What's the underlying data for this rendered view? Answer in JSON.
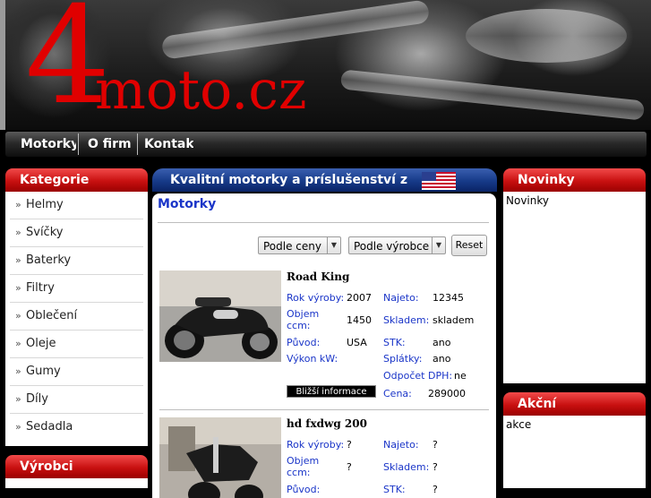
{
  "logo": {
    "four": "4",
    "rest": "moto.cz"
  },
  "nav": [
    {
      "label": "Motorky"
    },
    {
      "label": "O firm"
    },
    {
      "label": "Kontak"
    }
  ],
  "left": {
    "categories_title": "Kategorie",
    "categories": [
      "Helmy",
      "Svíčky",
      "Baterky",
      "Filtry",
      "Oblečení",
      "Oleje",
      "Gumy",
      "Díly",
      "Sedadla"
    ],
    "arrow": "»",
    "vyrobci_title": "Výrobci"
  },
  "center": {
    "slogan": "Kvalitní motorky a príslušenství z",
    "flag_icon": "us-flag-icon",
    "heading": "Motorky",
    "sort_price": "Podle ceny",
    "sort_maker": "Podle výrobce",
    "reset": "Reset",
    "products": [
      {
        "name": "Road King",
        "rok_label": "Rok výroby:",
        "rok": "2007",
        "najeto_label": "Najeto:",
        "najeto": "12345",
        "objem_label": "Objem ccm:",
        "objem": "1450",
        "skladem_label": "Skladem:",
        "skladem": "skladem",
        "puvod_label": "Původ:",
        "puvod": "USA",
        "stk_label": "STK:",
        "stk": "ano",
        "vykon_label": "Výkon kW:",
        "vykon": "",
        "splatky_label": "Splátky:",
        "splatky": "ano",
        "odpocet_label": "Odpočet DPH:",
        "odpocet": "ne",
        "info": "Bližší informace",
        "cena_label": "Cena:",
        "cena": "289000"
      },
      {
        "name": "hd fxdwg 200",
        "rok_label": "Rok výroby:",
        "rok": "?",
        "najeto_label": "Najeto:",
        "najeto": "?",
        "objem_label": "Objem ccm:",
        "objem": "?",
        "skladem_label": "Skladem:",
        "skladem": "?",
        "puvod_label": "Původ:",
        "puvod": "",
        "stk_label": "STK:",
        "stk": "?"
      }
    ]
  },
  "right": {
    "novinky_title": "Novinky",
    "novinky_text": "Novinky",
    "akcni_title": "Akční",
    "akcni_text": "akce"
  },
  "colors": {
    "red": "#c81010",
    "blue_link": "#1a35c8",
    "slogan_blue": "#163a88",
    "logo_red": "#e00000"
  }
}
